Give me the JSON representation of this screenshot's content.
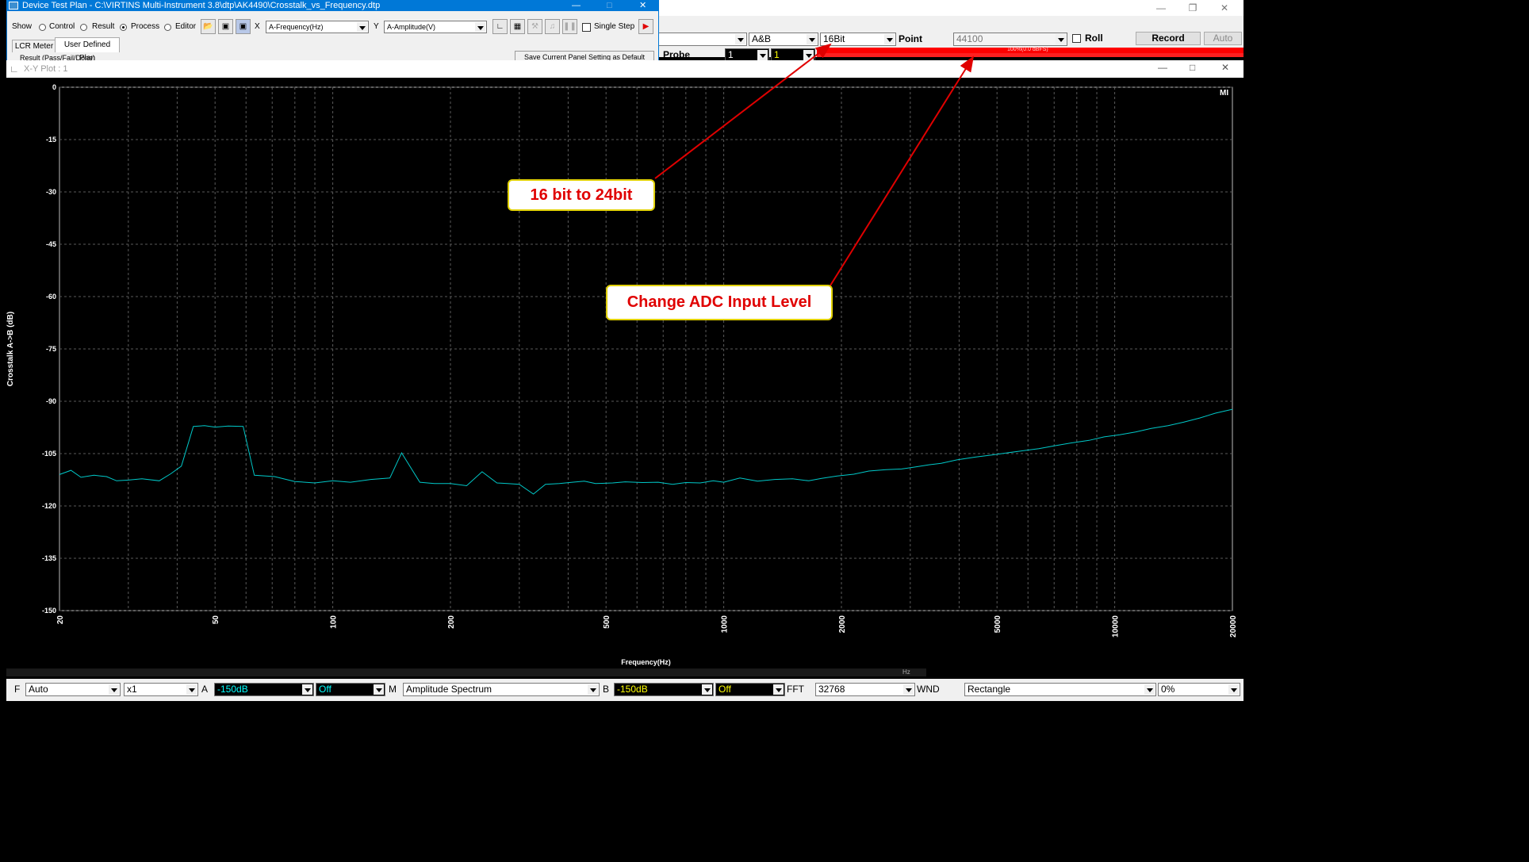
{
  "dtp": {
    "title": "Device Test Plan - C:\\VIRTINS Multi-Instrument 3.8\\dtp\\AK4490\\Crosstalk_vs_Frequency.dtp",
    "show_label": "Show",
    "radios": [
      "Control",
      "Result",
      "Process",
      "Editor"
    ],
    "selected_radio": "Process",
    "x_label": "X",
    "x_value": "A-Frequency(Hz)",
    "y_label": "Y",
    "y_value": "A-Amplitude(V)",
    "single_step": "Single Step",
    "tabs": [
      "LCR Meter",
      "User Defined Plan"
    ],
    "result_text": "Result (Pass/Fail/Done)",
    "save_text": "Save Current Panel Setting as Default"
  },
  "main": {
    "channel": "A&B",
    "bits": "16Bit",
    "point_label": "Point",
    "point_value": "44100",
    "roll": "Roll",
    "record": "Record",
    "auto": "Auto",
    "probe": "Probe",
    "probe_a": "1",
    "probe_b": "1",
    "level_text": "100%(0.0 dBFS)"
  },
  "xy": {
    "title": "X-Y Plot : 1",
    "mi": "MI"
  },
  "bottom": {
    "f_label": "F",
    "f_value": "Auto",
    "mult": "x1",
    "a_label": "A",
    "a_value": "-150dB",
    "a_off": "Off",
    "m_label": "M",
    "m_value": "Amplitude Spectrum",
    "b_label": "B",
    "b_value": "-150dB",
    "b_off": "Off",
    "fft_label": "FFT",
    "fft_value": "32768",
    "wnd_label": "WND",
    "wnd_value": "Rectangle",
    "pct": "0%",
    "hz": "Hz"
  },
  "callouts": {
    "bits": "16 bit to 24bit",
    "adc": "Change ADC Input Level"
  },
  "colors": {
    "trace": "#00c8c8",
    "accent": "#0078d7",
    "callout_text": "#e00000",
    "arrow": "#e00000"
  },
  "chart_data": {
    "type": "line",
    "xlabel": "Frequency(Hz)",
    "ylabel": "Crosstalk A->B (dB)",
    "x_scale": "log",
    "xlim": [
      20,
      20000
    ],
    "ylim": [
      -150,
      0
    ],
    "x_ticks": [
      20,
      50,
      100,
      200,
      500,
      1000,
      2000,
      5000,
      10000,
      20000
    ],
    "y_ticks": [
      0,
      -15,
      -30,
      -45,
      -60,
      -75,
      -90,
      -105,
      -120,
      -135,
      -150
    ],
    "grid": true,
    "series": [
      {
        "x": [
          20,
          21.4,
          22.7,
          24.5,
          26.4,
          28,
          30,
          32.5,
          36,
          38.5,
          41,
          44,
          47,
          50,
          54,
          59,
          63,
          71,
          80,
          90,
          100,
          111,
          125,
          140,
          150,
          167,
          182,
          200,
          220,
          241,
          263,
          280,
          300,
          326,
          350,
          380,
          410,
          440,
          470,
          520,
          560,
          620,
          680,
          740,
          800,
          870,
          940,
          1000,
          1100,
          1220,
          1350,
          1500,
          1650,
          1780,
          1950,
          2150,
          2350,
          2600,
          2850,
          3100,
          3350,
          3600,
          3950,
          4400,
          4850,
          5300,
          5800,
          6400,
          7000,
          7700,
          8600,
          9400,
          10300,
          11300,
          12400,
          13700,
          15000,
          16500,
          18100,
          20000
        ],
        "y": [
          -111,
          -109.8,
          -111.8,
          -111.2,
          -111.6,
          -112.8,
          -112.6,
          -112.2,
          -112.8,
          -110.8,
          -108.6,
          -97.2,
          -97,
          -97.4,
          -97.1,
          -97.2,
          -111.2,
          -111.6,
          -113,
          -113.4,
          -112.8,
          -113.2,
          -112.4,
          -112,
          -104.8,
          -113.2,
          -113.6,
          -113.6,
          -114.2,
          -110.2,
          -113.4,
          -113.6,
          -113.8,
          -116.6,
          -113.8,
          -113.6,
          -113.2,
          -112.9,
          -113.6,
          -113.4,
          -113.1,
          -113.3,
          -113.2,
          -113.8,
          -113.3,
          -113.4,
          -112.8,
          -113.2,
          -112,
          -112.9,
          -112.4,
          -112.2,
          -112.8,
          -112.1,
          -111.4,
          -110.9,
          -110,
          -109.6,
          -109.4,
          -108.8,
          -108.2,
          -107.8,
          -106.8,
          -106,
          -105.4,
          -104.8,
          -104.2,
          -103.6,
          -102.8,
          -102,
          -101.2,
          -100.2,
          -99.6,
          -98.8,
          -97.8,
          -97,
          -96,
          -94.8,
          -93.4,
          -92.3
        ]
      }
    ]
  }
}
